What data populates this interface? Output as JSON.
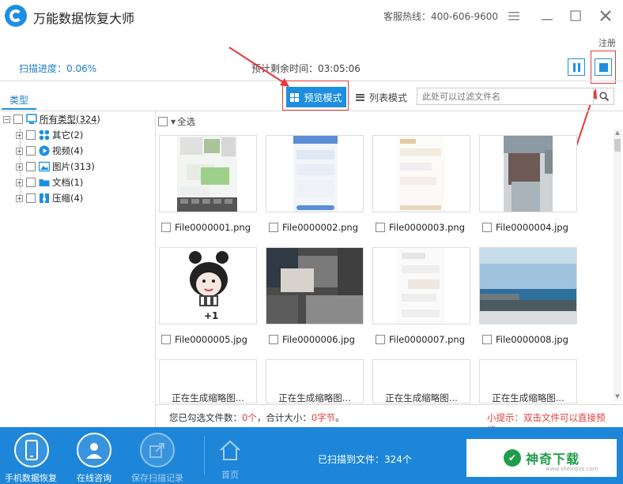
{
  "app": {
    "title": "万能数据恢复大师",
    "hotline": "客服热线：400-606-9600",
    "register": "注册"
  },
  "window_buttons": [
    "menu-icon",
    "minimize-icon",
    "maximize-icon",
    "close-icon"
  ],
  "scan": {
    "progress_label": "扫描进度：0.06%",
    "remaining_label": "预计剩余时间：03:05:06",
    "progress": 0.06
  },
  "toolbar": {
    "type_tab": "类型",
    "preview_mode": "预览模式",
    "list_mode": "列表模式",
    "search_placeholder": "此处可以过滤文件名",
    "select_all": "全选"
  },
  "tree": {
    "root": "所有类型(324)",
    "children": [
      {
        "label": "其它(2)",
        "icon": "other-icon",
        "color": "#1e8fe0"
      },
      {
        "label": "视频(4)",
        "icon": "video-icon",
        "color": "#1e8fe0"
      },
      {
        "label": "图片(313)",
        "icon": "image-icon",
        "color": "#1e8fe0"
      },
      {
        "label": "文档(1)",
        "icon": "folder-icon",
        "color": "#1e8fe0"
      },
      {
        "label": "压缩(4)",
        "icon": "archive-icon",
        "color": "#1e8fe0"
      }
    ]
  },
  "files": [
    {
      "name": "File0000001.png"
    },
    {
      "name": "File0000002.png"
    },
    {
      "name": "File0000003.png"
    },
    {
      "name": "File0000004.jpg"
    },
    {
      "name": "File0000005.jpg"
    },
    {
      "name": "File0000006.jpg"
    },
    {
      "name": "File0000007.png"
    },
    {
      "name": "File0000008.jpg"
    }
  ],
  "generating": [
    "正在生成缩略图...",
    "正在生成缩略图...",
    "正在生成缩略图...",
    "正在生成缩略图..."
  ],
  "thumb_texts": {
    "meme_caption": "+1"
  },
  "status": {
    "selected_prefix": "您已勾选文件数：",
    "selected_count": "0个",
    "total_prefix": "，合计大小：",
    "total_size": "0字节",
    "suffix": "。",
    "tip": "小提示：双击文件可以直接预览。"
  },
  "bottom": {
    "phone_recovery": "手机数据恢复",
    "online_consult": "在线咨询",
    "save_scan": "保存扫描记录",
    "home": "首页",
    "scanned": "已扫描到文件：324个"
  },
  "watermark": {
    "text": "神奇下载",
    "small": "www.shenqizz.com"
  },
  "colors": {
    "accent": "#1e8fe0",
    "highlight_red": "#e23b3b",
    "bottom_bar": "#1d86d9"
  }
}
